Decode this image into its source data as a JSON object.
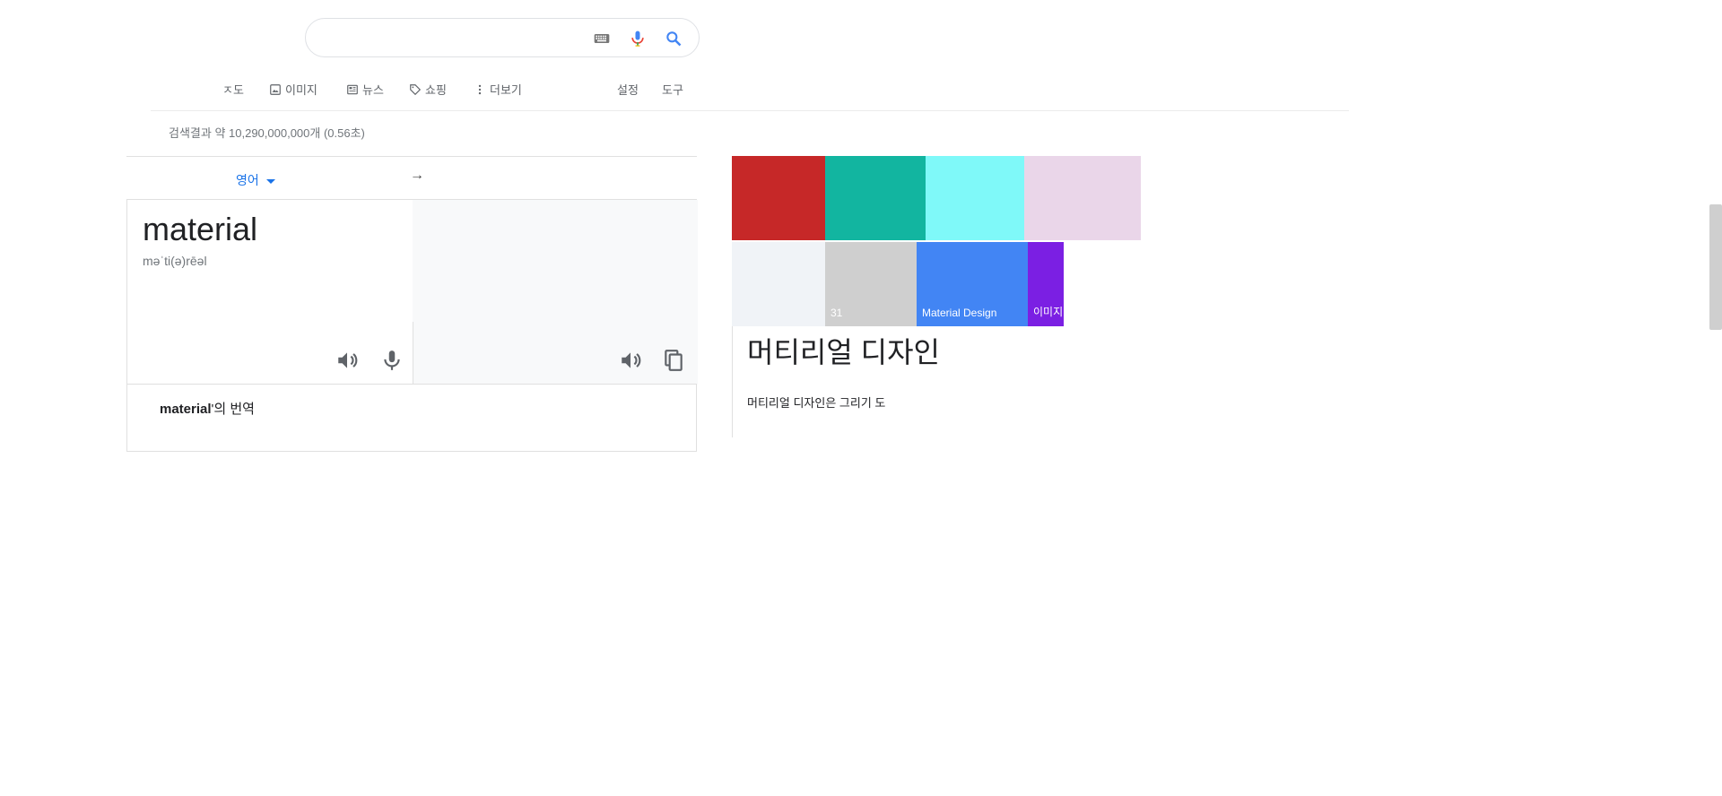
{
  "search": {
    "value": "",
    "placeholder": ""
  },
  "icons": {
    "keyboard": "keyboard-icon",
    "mic": "mic-icon",
    "search": "search-icon"
  },
  "tabs": {
    "all": "ㅈ도",
    "images": "이미지",
    "news": "뉴스",
    "shopping": "쇼핑",
    "more": "더보기",
    "settings": "설정",
    "tools": "도구"
  },
  "result_stats": "검색결과 약 10,290,000,000개 (0.56초)",
  "translate": {
    "source_lang": "영어",
    "swap_symbol": "→",
    "source_word": "material",
    "phonetic": "məˈti(ə)rēəl",
    "footer_word": "material",
    "footer_suffix": "'의 번역"
  },
  "knowledge": {
    "title": "머티리얼 디자인",
    "description": "머티리얼 디자인은 그리기 도"
  },
  "image_tiles": [
    {
      "label": "",
      "color": "#c62828"
    },
    {
      "label": "",
      "color": "#12b5a0"
    },
    {
      "label": "",
      "color": "#7ff9f9"
    },
    {
      "label": "",
      "color": "#ead6e9"
    },
    {
      "label": "",
      "color": "#f0f3f7"
    },
    {
      "label": "31",
      "color": "#cfcfcf"
    },
    {
      "label": "Material Design",
      "color": "#4285f4"
    },
    {
      "label": "이미지",
      "color": "#7b1fe3"
    }
  ],
  "colors": {
    "link": "#1a73e8",
    "muted": "#70757a",
    "border": "#e0e0e0"
  }
}
